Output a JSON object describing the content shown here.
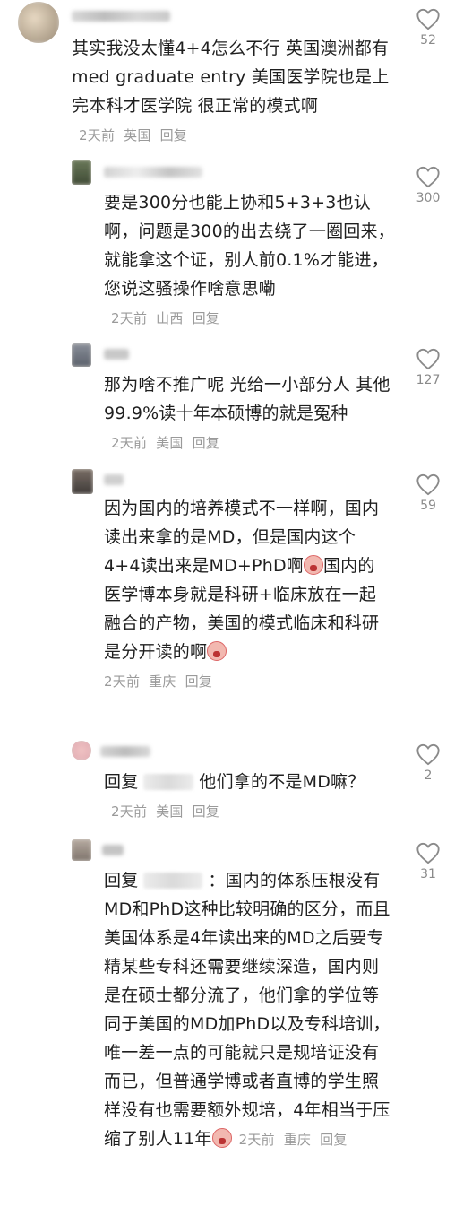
{
  "comments": [
    {
      "text": "其实我没太懂4+4怎么不行 英国澳洲都有med graduate entry 美国医学院也是上完本科才医学院 很正常的模式啊",
      "time": "2天前",
      "location": "英国",
      "reply_label": "回复",
      "likes": "52"
    },
    {
      "text": "要是300分也能上协和5+3+3也认啊，问题是300的出去绕了一圈回来，就能拿这个证，别人前0.1%才能进，您说这骚操作啥意思嘞",
      "time": "2天前",
      "location": "山西",
      "reply_label": "回复",
      "likes": "300"
    },
    {
      "text": "那为啥不推广呢 光给一小部分人 其他99.9%读十年本硕博的就是冤种",
      "time": "2天前",
      "location": "美国",
      "reply_label": "回复",
      "likes": "127"
    },
    {
      "text_a": "因为国内的培养模式不一样啊，国内读出来拿的是MD，但是国内这个4+4读出来是MD+PhD啊",
      "text_b": "国内的医学博本身就是科研+临床放在一起融合的产物，美国的模式临床和科研是分开读的啊",
      "time": "2天前",
      "location": "重庆",
      "reply_label": "回复",
      "likes": "59"
    },
    {
      "prefix": "回复",
      "text": "他们拿的不是MD嘛？",
      "time": "2天前",
      "location": "美国",
      "reply_label": "回复",
      "likes": "2"
    },
    {
      "prefix": "回复",
      "text": "：国内的体系压根没有MD和PhD这种比较明确的区分，而且美国体系是4年读出来的MD之后要专精某些专科还需要继续深造，国内则是在硕士都分流了，他们拿的学位等同于美国的MD加PhD以及专科培训，唯一差一点的可能就只是规培证没有而已，但普通学博或者直博的学生照样没有也需要额外规培，4年相当于压缩了别人11年",
      "time": "2天前",
      "location": "重庆",
      "reply_label": "回复",
      "likes": "31"
    }
  ],
  "colors": {
    "meta": "#9a9a9a",
    "text": "#1f1f1f",
    "heart_stroke": "#8a8a8a"
  },
  "icons": {
    "like": "heart-outline-icon",
    "emoji": "crying-emoji-icon"
  }
}
